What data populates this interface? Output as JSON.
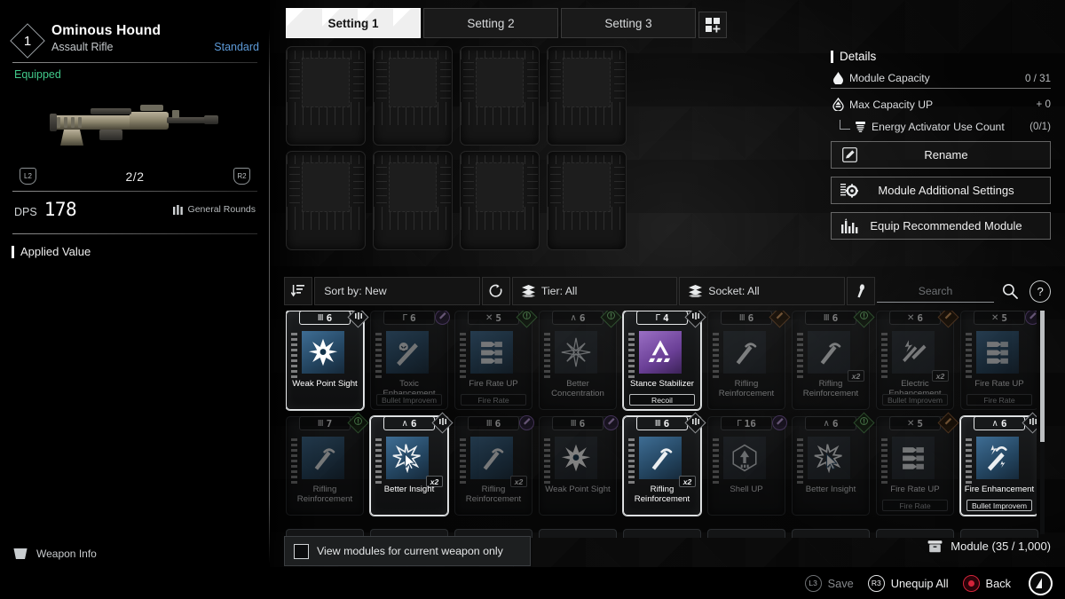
{
  "weapon": {
    "level": "1",
    "name": "Ominous Hound",
    "type": "Assault Rifle",
    "rarity": "Standard",
    "status": "Equipped",
    "left_bumper": "L2",
    "right_bumper": "R2",
    "ammo": "2/2",
    "dps_label": "DPS",
    "dps_value": "178",
    "ammo_type": "General Rounds",
    "applied_value_label": "Applied Value",
    "weapon_info_label": "Weapon Info"
  },
  "tabs": [
    {
      "label": "Setting 1",
      "active": true
    },
    {
      "label": "Setting 2",
      "active": false
    },
    {
      "label": "Setting 3",
      "active": false
    }
  ],
  "tab_add_label": "+",
  "slot_count": 8,
  "details": {
    "title": "Details",
    "rows": [
      {
        "icon": "droplet-icon",
        "label": "Module Capacity",
        "value": "0 / 31",
        "underline": true,
        "sub": false
      },
      {
        "icon": "capacity-up-icon",
        "label": "Max Capacity UP",
        "value": "+ 0",
        "underline": false,
        "sub": false
      },
      {
        "icon": "energy-activator-icon",
        "label": "Energy Activator Use Count",
        "value": "(0/1)",
        "underline": false,
        "sub": true
      }
    ],
    "buttons": [
      {
        "icon": "pencil-icon",
        "label": "Rename"
      },
      {
        "icon": "module-settings-icon",
        "label": "Module Additional Settings"
      },
      {
        "icon": "recommend-icon",
        "label": "Equip Recommended Module"
      }
    ]
  },
  "filter": {
    "sort_icon": "sort-descending-icon",
    "sort_label": "Sort by: New",
    "reset_icon": "reset-icon",
    "tier_label": "Tier: All",
    "socket_label": "Socket: All",
    "socket_type_icon": "socket-key-icon",
    "search_placeholder": "Search",
    "search_value": "",
    "search_icon": "search-icon",
    "help_label": "?"
  },
  "modules": [
    {
      "glyph": "M",
      "tier": "6",
      "name": "Weak Point Sight",
      "footer": "",
      "badge": "capacity",
      "icon": "burst-icon",
      "icon_style": "blue",
      "selected": true,
      "mult": ""
    },
    {
      "glyph": "I",
      "tier": "6",
      "name": "Toxic Enhancement",
      "footer": "Bullet Improvem",
      "badge": "purple",
      "icon": "toxic-icon",
      "icon_style": "blue",
      "selected": false,
      "mult": ""
    },
    {
      "glyph": "X",
      "tier": "5",
      "name": "Fire Rate UP",
      "footer": "Fire Rate",
      "badge": "green",
      "icon": "bullets-icon",
      "icon_style": "blue",
      "selected": false,
      "mult": ""
    },
    {
      "glyph": "A",
      "tier": "6",
      "name": "Better Concentration",
      "footer": "",
      "badge": "green",
      "icon": "starburst-icon",
      "icon_style": "flat",
      "selected": false,
      "mult": ""
    },
    {
      "glyph": "I",
      "tier": "4",
      "name": "Stance Stabilizer",
      "footer": "Recoil",
      "badge": "capacity",
      "icon": "stance-icon",
      "icon_style": "purple",
      "selected": true,
      "mult": ""
    },
    {
      "glyph": "M",
      "tier": "6",
      "name": "Rifling Reinforcement",
      "footer": "",
      "badge": "orange",
      "icon": "rifling-icon",
      "icon_style": "flat",
      "selected": false,
      "mult": ""
    },
    {
      "glyph": "M",
      "tier": "6",
      "name": "Rifling Reinforcement",
      "footer": "",
      "badge": "green",
      "icon": "rifling-icon",
      "icon_style": "flat",
      "selected": false,
      "mult": "x2"
    },
    {
      "glyph": "X",
      "tier": "6",
      "name": "Electric Enhancement",
      "footer": "Bullet Improvem",
      "badge": "orange",
      "icon": "electric-icon",
      "icon_style": "flat",
      "selected": false,
      "mult": "x2"
    },
    {
      "glyph": "X",
      "tier": "5",
      "name": "Fire Rate UP",
      "footer": "Fire Rate",
      "badge": "purple",
      "icon": "bullets-icon",
      "icon_style": "blue",
      "selected": false,
      "mult": ""
    },
    {
      "glyph": "M",
      "tier": "7",
      "name": "Rifling Reinforcement",
      "footer": "",
      "badge": "green",
      "icon": "rifling-icon",
      "icon_style": "blue",
      "selected": false,
      "mult": ""
    },
    {
      "glyph": "A",
      "tier": "6",
      "name": "Better Insight",
      "footer": "",
      "badge": "capacity",
      "icon": "insight-icon",
      "icon_style": "blue",
      "selected": true,
      "mult": "x2"
    },
    {
      "glyph": "M",
      "tier": "6",
      "name": "Rifling Reinforcement",
      "footer": "",
      "badge": "purple",
      "icon": "rifling-icon",
      "icon_style": "blue",
      "selected": false,
      "mult": "x2"
    },
    {
      "glyph": "M",
      "tier": "6",
      "name": "Weak Point Sight",
      "footer": "",
      "badge": "purple",
      "icon": "burst-icon",
      "icon_style": "flat",
      "selected": false,
      "mult": ""
    },
    {
      "glyph": "M",
      "tier": "6",
      "name": "Rifling Reinforcement",
      "footer": "",
      "badge": "capacity",
      "icon": "rifling-icon",
      "icon_style": "blue",
      "selected": true,
      "mult": "x2"
    },
    {
      "glyph": "I",
      "tier": "16",
      "name": "Shell UP",
      "footer": "",
      "badge": "purple",
      "icon": "shell-icon",
      "icon_style": "flat",
      "selected": false,
      "mult": ""
    },
    {
      "glyph": "A",
      "tier": "6",
      "name": "Better Insight",
      "footer": "",
      "badge": "green",
      "icon": "insight-icon",
      "icon_style": "flat",
      "selected": false,
      "mult": ""
    },
    {
      "glyph": "X",
      "tier": "5",
      "name": "Fire Rate UP",
      "footer": "Fire Rate",
      "badge": "orange",
      "icon": "bullets-icon",
      "icon_style": "flat",
      "selected": false,
      "mult": ""
    },
    {
      "glyph": "A",
      "tier": "6",
      "name": "Fire Enhancement",
      "footer": "Bullet Improvem",
      "badge": "capacity",
      "icon": "fire-icon",
      "icon_style": "blue",
      "selected": true,
      "mult": ""
    }
  ],
  "bottom": {
    "checkbox_label": "View modules for current weapon only",
    "checkbox_checked": false,
    "module_count_icon": "inventory-icon",
    "module_count": "Module (35 / 1,000)"
  },
  "footer_actions": [
    {
      "key": "L3",
      "label": "Save",
      "style": "dim"
    },
    {
      "key": "R3",
      "label": "Unequip All",
      "style": "lit"
    },
    {
      "key": "●",
      "label": "Back",
      "style": "red"
    }
  ]
}
